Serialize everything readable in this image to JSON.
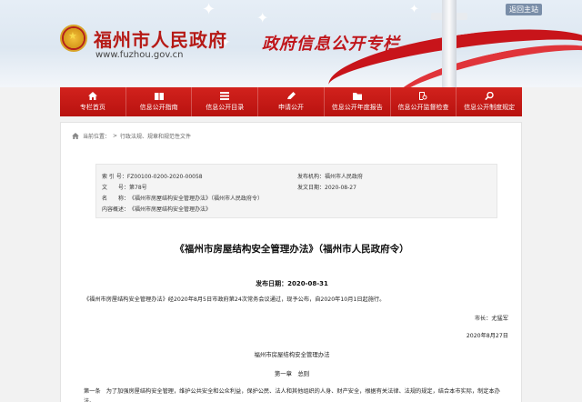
{
  "header": {
    "site_title": "福州市人民政府",
    "site_url": "www.fuzhou.gov.cn",
    "portal_title": "政府信息公开专栏",
    "home_link": "返回主站"
  },
  "nav": {
    "items": [
      {
        "label": "专栏首页",
        "icon": "home-icon"
      },
      {
        "label": "信息公开指南",
        "icon": "book-icon"
      },
      {
        "label": "信息公开目录",
        "icon": "list-icon"
      },
      {
        "label": "申请公开",
        "icon": "pencil-icon"
      },
      {
        "label": "信息公开年度报告",
        "icon": "folder-icon"
      },
      {
        "label": "信息公开监督检查",
        "icon": "search-doc-icon"
      },
      {
        "label": "信息公开制度规定",
        "icon": "magnifier-icon"
      }
    ]
  },
  "breadcrumb": {
    "prefix": "当前位置：",
    "path": "行政法规、规章和规范性文件"
  },
  "meta": {
    "index_label": "索 引 号：",
    "index_value": "FZ00100-0200-2020-00058",
    "docno_label": "文　　号：",
    "docno_value": "第78号",
    "name_label": "名　　称：",
    "name_value": "《福州市房屋结构安全管理办法》（福州市人民政府令）",
    "summary_label": "内容概述：",
    "summary_value": "《福州市房屋结构安全管理办法》",
    "org_label": "发布机构：",
    "org_value": "福州市人民政府",
    "date_label": "发文日期：",
    "date_value": "2020-08-27"
  },
  "article": {
    "title": "《福州市房屋结构安全管理办法》（福州市人民政府令）",
    "pubdate_label": "发布日期：",
    "pubdate_value": "2020-08-31",
    "intro": "《福州市房屋结构安全管理办法》经2020年8月5日市政府第24次常务会议通过，现予公布，自2020年10月1日起施行。",
    "signature": "市长：尤猛军",
    "sign_date": "2020年8月27日",
    "subtitle": "福州市房屋结构安全管理办法",
    "chapter": "第一章　总则",
    "article1": "第一条　为了加强房屋结构安全管理，维护公共安全和公众利益，保护公民、法人和其他组织的人身、财产安全，根据有关法律、法规的规定，结合本市实际，制定本办法。"
  },
  "colors": {
    "brand_red": "#c0161b",
    "nav_red": "#c8191a"
  }
}
